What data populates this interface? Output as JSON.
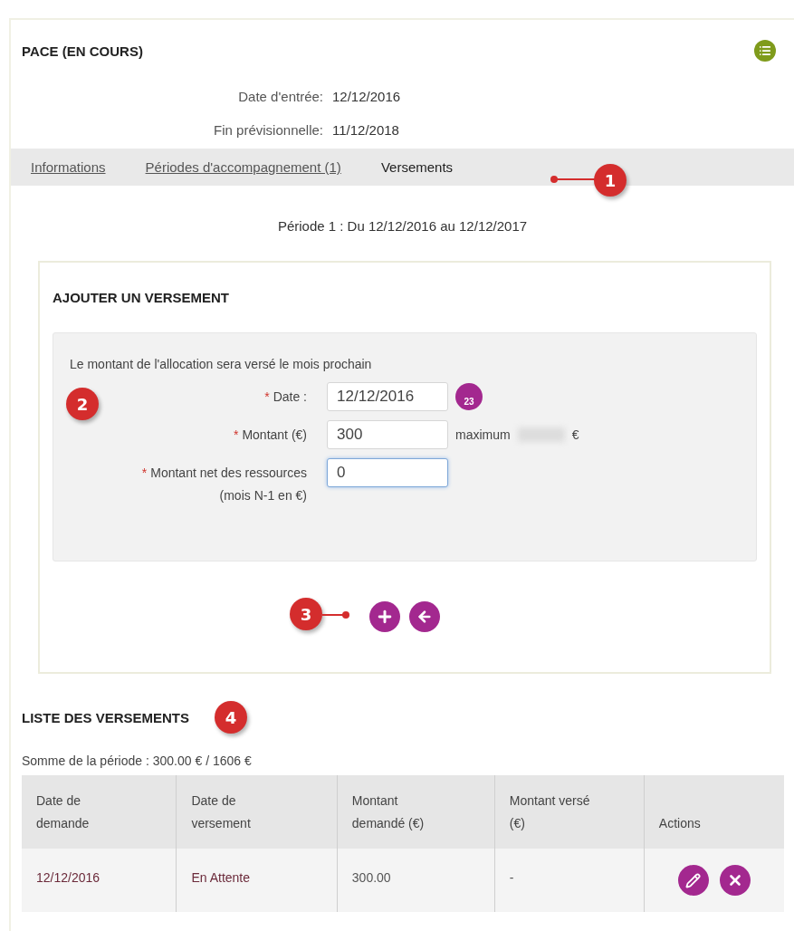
{
  "header": {
    "title": "PACE (EN COURS)",
    "fields": [
      {
        "label": "Date d'entrée:",
        "value": "12/12/2016"
      },
      {
        "label": "Fin prévisionnelle:",
        "value": "11/12/2018"
      }
    ]
  },
  "tabs": [
    {
      "label": "Informations",
      "selected": false
    },
    {
      "label": "Périodes d'accompagnement (1)",
      "selected": false
    },
    {
      "label": "Versements",
      "selected": true
    }
  ],
  "period": "Période 1 : Du 12/12/2016 au 12/12/2017",
  "form": {
    "title": "AJOUTER UN VERSEMENT",
    "note": "Le montant de l'allocation sera versé le mois prochain",
    "fields": [
      {
        "kind": "date",
        "required_mark": "*",
        "label": "Date :",
        "value": "12/12/2016",
        "focused": false,
        "calendar_day": "23"
      },
      {
        "kind": "amount",
        "required_mark": "*",
        "label": "Montant (€)",
        "value": "300",
        "focused": false,
        "hint": "maximum",
        "hint_suffix": "€"
      },
      {
        "kind": "text",
        "required_mark": "*",
        "label": "Montant net des ressources (mois N-1 en €)",
        "value": "0",
        "focused": true
      }
    ]
  },
  "list": {
    "title": "LISTE DES VERSEMENTS",
    "sum": "Somme de la période : 300.00 € / 1606 €",
    "columns": [
      "Date de demande",
      "Date de versement",
      "Montant demandé (€)",
      "Montant versé (€)",
      "Actions"
    ],
    "rows": [
      {
        "cells": [
          "12/12/2016",
          "En Attente",
          "300.00",
          "-"
        ]
      }
    ]
  },
  "callouts": [
    "1",
    "2",
    "3",
    "4"
  ]
}
